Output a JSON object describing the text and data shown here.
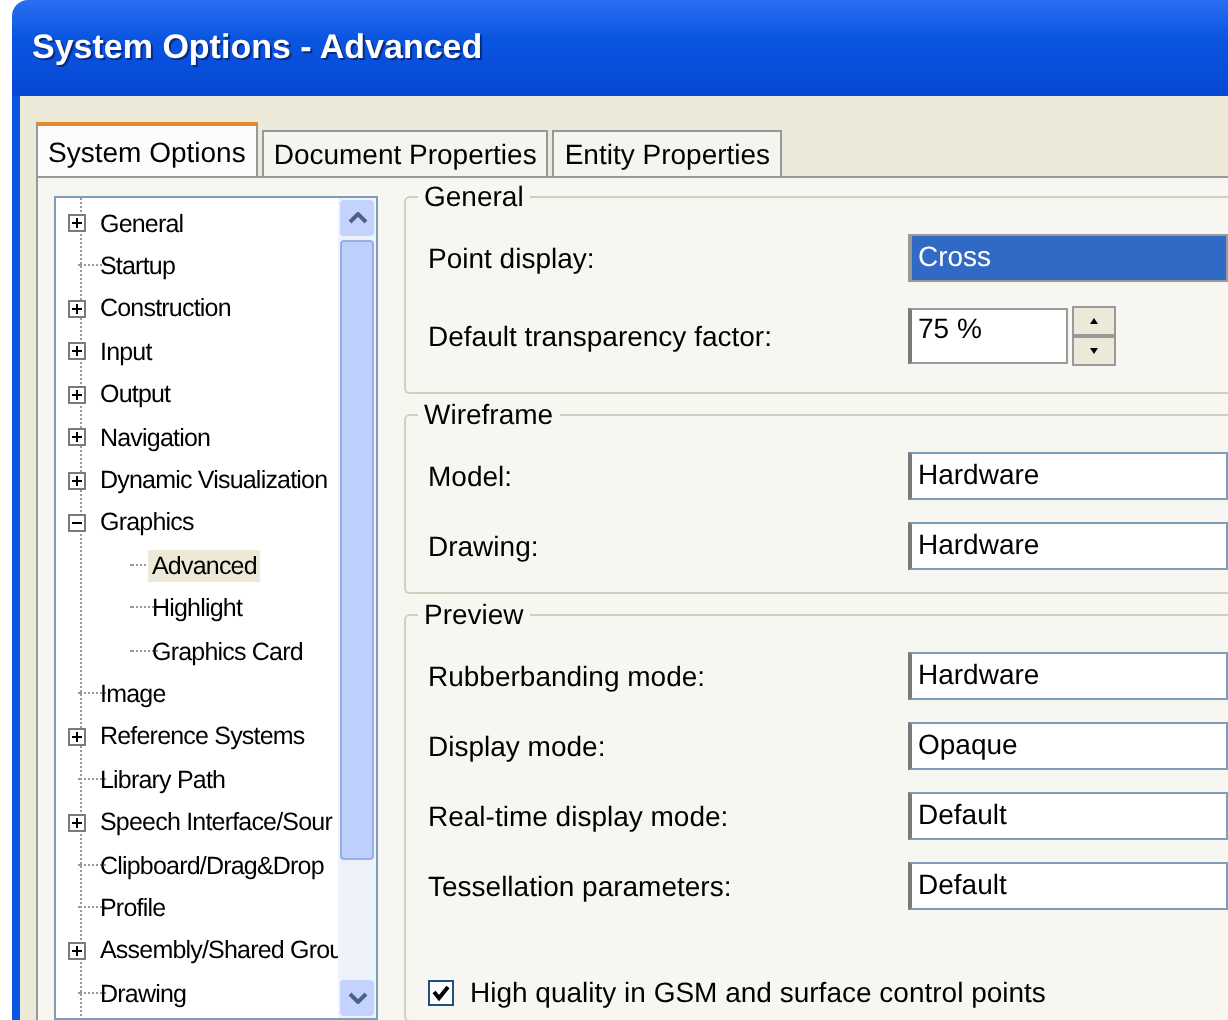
{
  "window": {
    "title": "System Options - Advanced"
  },
  "tabs": [
    {
      "label": "System Options",
      "selected": true
    },
    {
      "label": "Document Properties",
      "selected": false
    },
    {
      "label": "Entity Properties",
      "selected": false
    }
  ],
  "tree": [
    {
      "label": "General",
      "kind": "node",
      "expanded": false,
      "selected": false
    },
    {
      "label": "Startup",
      "kind": "leaf",
      "selected": false
    },
    {
      "label": "Construction",
      "kind": "node",
      "expanded": false,
      "selected": false
    },
    {
      "label": "Input",
      "kind": "node",
      "expanded": false,
      "selected": false
    },
    {
      "label": "Output",
      "kind": "node",
      "expanded": false,
      "selected": false
    },
    {
      "label": "Navigation",
      "kind": "node",
      "expanded": false,
      "selected": false
    },
    {
      "label": "Dynamic Visualization",
      "kind": "node",
      "expanded": false,
      "selected": false
    },
    {
      "label": "Graphics",
      "kind": "node",
      "expanded": true,
      "selected": false,
      "children": [
        {
          "label": "Advanced",
          "selected": true
        },
        {
          "label": "Highlight",
          "selected": false
        },
        {
          "label": "Graphics Card",
          "selected": false
        }
      ]
    },
    {
      "label": "Image",
      "kind": "leaf",
      "selected": false
    },
    {
      "label": "Reference Systems",
      "kind": "node",
      "expanded": false,
      "selected": false
    },
    {
      "label": "Library Path",
      "kind": "leaf",
      "selected": false
    },
    {
      "label": "Speech Interface/Sour",
      "kind": "node",
      "expanded": false,
      "selected": false
    },
    {
      "label": "Clipboard/Drag&Drop",
      "kind": "leaf",
      "selected": false
    },
    {
      "label": "Profile",
      "kind": "leaf",
      "selected": false
    },
    {
      "label": "Assembly/Shared Grou",
      "kind": "node",
      "expanded": false,
      "selected": false
    },
    {
      "label": "Drawing",
      "kind": "leaf",
      "selected": false
    }
  ],
  "groups": [
    {
      "title": "General",
      "fields": [
        {
          "label": "Point display:",
          "kind": "dropdown",
          "value": "Cross",
          "selected": true
        },
        {
          "label": "Default transparency factor:",
          "kind": "spin",
          "value": "75 %",
          "selected": false
        }
      ]
    },
    {
      "title": "Wireframe",
      "fields": [
        {
          "label": "Model:",
          "kind": "dropdown",
          "value": "Hardware",
          "selected": false
        },
        {
          "label": "Drawing:",
          "kind": "dropdown",
          "value": "Hardware",
          "selected": false
        }
      ]
    },
    {
      "title": "Preview",
      "fields": [
        {
          "label": "Rubberbanding mode:",
          "kind": "dropdown",
          "value": "Hardware",
          "selected": false
        },
        {
          "label": "Display mode:",
          "kind": "dropdown",
          "value": "Opaque",
          "selected": false
        },
        {
          "label": "Real-time display mode:",
          "kind": "dropdown",
          "value": "Default",
          "selected": false
        },
        {
          "label": "Tessellation parameters:",
          "kind": "dropdown",
          "value": "Default",
          "selected": false
        }
      ],
      "checkbox": {
        "label": "High quality in GSM and surface control points",
        "checked": true
      }
    }
  ]
}
